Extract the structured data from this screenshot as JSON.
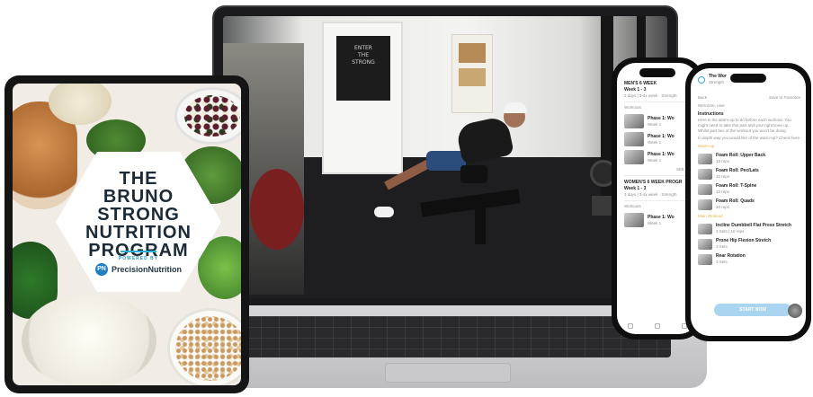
{
  "laptop": {
    "poster_text": "ENTER\nTHE\nSTRONG"
  },
  "tablet": {
    "title_line1": "THE",
    "title_line2": "BRUNO",
    "title_line3": "STRONG",
    "title_line4": "NUTRITION",
    "title_line5": "PROGRAM",
    "powered_by": "POWERED BY",
    "brand_logo_letter": "PN",
    "brand_name": "PrecisionNutrition"
  },
  "phone_back": {
    "header": "MEN'S 6 WEEK",
    "week_label": "Week 1 - 3",
    "schedule_note": "3 days | 3-4x week · Strength",
    "section_label": "Workouts",
    "items": [
      {
        "title": "Phase 1: Wo",
        "meta": "Week 1"
      },
      {
        "title": "Phase 1: Wo",
        "meta": "Week 1"
      },
      {
        "title": "Phase 1: Wo",
        "meta": "Week 1"
      }
    ],
    "see_all": "SEE ALL",
    "header2": "WOMEN'S 6 WEEK PROGR",
    "week_label2": "Week 1 - 3",
    "schedule_note2": "3 days | 3-4x week · Strength",
    "section_label2": "Workouts",
    "items2": [
      {
        "title": "Phase 1: Wo",
        "meta": "Week 1"
      }
    ]
  },
  "phone_front": {
    "title": "The Wor",
    "subtitle": "Strength",
    "back_label": "Back",
    "share_label": "Save to Favorites",
    "desc": "Welcome, user",
    "instructions_label": "Instructions",
    "instructions": [
      "Here is the warm-up to do before each workout. You",
      "might need to take this part and your right knee up.",
      "Whilst part two of the workout you won't be doing."
    ],
    "link_text": "In depth way you would like of the warm-up? Check here",
    "section_warmup": "Warm-up",
    "warmup_items": [
      {
        "title": "Foam Roll: Upper Back",
        "meta": "10 reps"
      },
      {
        "title": "Foam Roll: Pec/Lats",
        "meta": "10 reps"
      },
      {
        "title": "Foam Roll: T-Spine",
        "meta": "10 reps"
      },
      {
        "title": "Foam Roll: Quads",
        "meta": "10 reps"
      }
    ],
    "section_main": "Main Workout",
    "main_items": [
      {
        "title": "Incline Dumbbell Flat Press Stretch",
        "meta": "3 Sets | 10 reps"
      },
      {
        "title": "Prone Hip Flexion Stretch",
        "meta": "3 Sets"
      },
      {
        "title": "Rear Rotation",
        "meta": "3 Sets"
      }
    ],
    "start_button": "START NOW"
  },
  "colors": {
    "laptop_frame": "#1b1b1d",
    "tablet_frame": "#151515",
    "phone_frame": "#0e0e0f",
    "brand_blue": "#1f7fc0",
    "accent_cyan": "#2fb0d7",
    "start_button": "#a9d5f0",
    "accent_gold": "#e1b54a",
    "title_text": "#1b2a36"
  }
}
